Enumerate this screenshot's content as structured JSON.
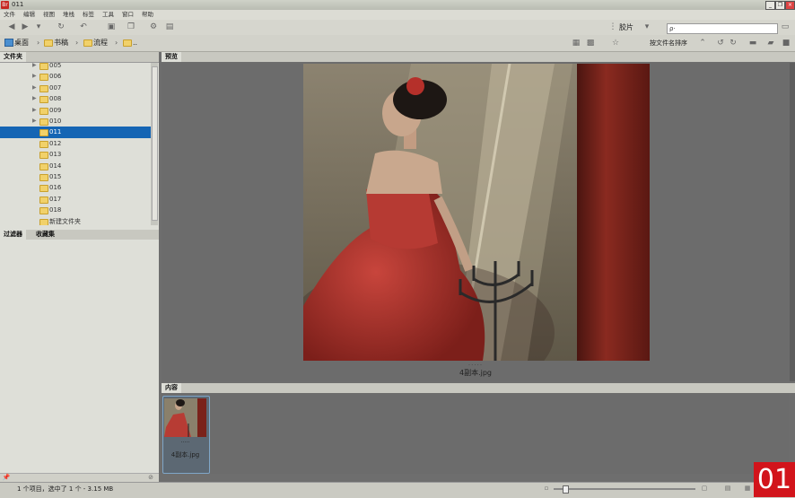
{
  "window": {
    "title": "011",
    "app_icon": "Br",
    "minimize": "_",
    "maximize": "❐",
    "close": "×"
  },
  "menu": [
    "文件",
    "编辑",
    "视图",
    "堆栈",
    "标签",
    "工具",
    "窗口",
    "帮助"
  ],
  "toolbar": {
    "view_label": "胶片",
    "search_placeholder": "ρ·"
  },
  "breadcrumb": [
    {
      "label": "桌面"
    },
    {
      "label": "书稿"
    },
    {
      "label": "流程"
    },
    {
      "label": ".."
    }
  ],
  "sort_label": "按文件名排序",
  "left_panel": {
    "top_tab": "文件夹",
    "tree": [
      {
        "label": "005",
        "arrow": true,
        "selected": false
      },
      {
        "label": "006",
        "arrow": true,
        "selected": false
      },
      {
        "label": "007",
        "arrow": true,
        "selected": false
      },
      {
        "label": "008",
        "arrow": true,
        "selected": false
      },
      {
        "label": "009",
        "arrow": true,
        "selected": false
      },
      {
        "label": "010",
        "arrow": true,
        "selected": false
      },
      {
        "label": "011",
        "arrow": false,
        "selected": true
      },
      {
        "label": "012",
        "arrow": false,
        "selected": false
      },
      {
        "label": "013",
        "arrow": false,
        "selected": false
      },
      {
        "label": "014",
        "arrow": false,
        "selected": false
      },
      {
        "label": "015",
        "arrow": false,
        "selected": false
      },
      {
        "label": "016",
        "arrow": false,
        "selected": false
      },
      {
        "label": "017",
        "arrow": false,
        "selected": false
      },
      {
        "label": "018",
        "arrow": false,
        "selected": false
      },
      {
        "label": "新建文件夹",
        "arrow": false,
        "selected": false
      }
    ],
    "bottom_tabs": [
      "过滤器",
      "收藏集"
    ]
  },
  "preview": {
    "tab": "预览",
    "caption": "4副本.jpg",
    "rating_dots": "·····"
  },
  "content": {
    "tab": "内容",
    "items": [
      {
        "label": "4副本.jpg",
        "rating_dots": "·····"
      }
    ]
  },
  "status": {
    "text": "1 个项目，选中了 1 个 - 3.15 MB"
  },
  "badge": {
    "text": "01"
  },
  "colors": {
    "selection": "#1565b4",
    "badge": "#d2141b"
  }
}
